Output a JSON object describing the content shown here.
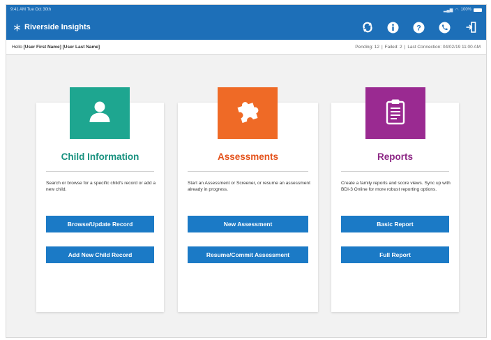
{
  "status_bar": {
    "time": "9:41 AM  Tue Oct 30th",
    "battery": "100%"
  },
  "header": {
    "brand": "Riverside Insights",
    "icons": [
      "sync-icon",
      "info-icon",
      "help-icon",
      "phone-icon",
      "logout-icon"
    ]
  },
  "info_bar": {
    "greeting": "Hello",
    "user_name": "[User First Name] [User Last Name]",
    "pending": "Pending: 12",
    "failed": "Failed: 2",
    "last_connection": "Last Connection: 04/02/19 11:00 AM"
  },
  "cards": [
    {
      "title": "Child Information",
      "description": "Search or browse for a specific child's record or add a new child.",
      "buttons": [
        "Browse/Update Record",
        "Add New Child Record"
      ],
      "icon": "person-icon",
      "color": "#1ea690"
    },
    {
      "title": "Assessments",
      "description": "Start an Assessment or Screener, or resume an assessment already in progress.",
      "buttons": [
        "New Assessment",
        "Resume/Commit Assessment"
      ],
      "icon": "puzzle-icon",
      "color": "#ef6a26"
    },
    {
      "title": "Reports",
      "description": "Create a family reports and score views. Sync up with BDI-3 Online for more robust reporting options.",
      "buttons": [
        "Basic Report",
        "Full Report"
      ],
      "icon": "clipboard-icon",
      "color": "#9a2a91"
    }
  ],
  "colors": {
    "header_blue": "#1d6fb8",
    "button_blue": "#1b7ac6"
  }
}
